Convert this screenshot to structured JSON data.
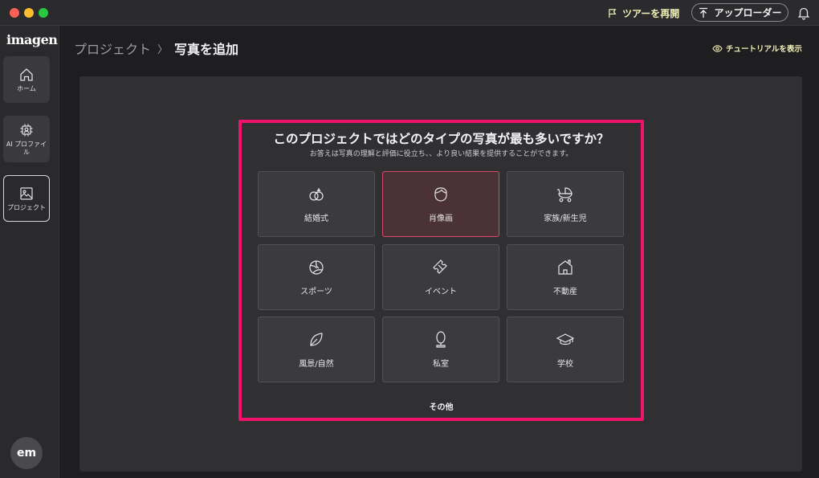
{
  "titlebar": {
    "tour_label": "ツアーを再開",
    "uploader_label": "アップローダー"
  },
  "sidebar": {
    "logo": "imagen",
    "items": [
      {
        "label": "ホーム",
        "icon": "home-icon"
      },
      {
        "label": "AI プロファイル",
        "icon": "ai-chip-icon"
      },
      {
        "label": "プロジェクト",
        "icon": "image-icon"
      }
    ],
    "avatar": "em"
  },
  "header": {
    "crumb_parent": "プロジェクト",
    "crumb_sep": "〉",
    "crumb_current": "写真を追加",
    "tutorial_label": "チュートリアルを表示"
  },
  "main": {
    "question": "このプロジェクトではどのタイプの写真が最も多いですか？",
    "subtitle": "お答えは写真の理解と評価に役立ち、、より良い結果を提供することができます。",
    "categories": [
      {
        "label": "結婚式",
        "icon": "wedding-rings-icon"
      },
      {
        "label": "肖像画",
        "icon": "portrait-icon"
      },
      {
        "label": "家族/新生児",
        "icon": "baby-stroller-icon"
      },
      {
        "label": "スポーツ",
        "icon": "volleyball-icon"
      },
      {
        "label": "イベント",
        "icon": "ticket-icon"
      },
      {
        "label": "不動産",
        "icon": "house-icon"
      },
      {
        "label": "風景/自然",
        "icon": "leaf-icon"
      },
      {
        "label": "私室",
        "icon": "mirror-icon"
      },
      {
        "label": "学校",
        "icon": "graduation-cap-icon"
      }
    ],
    "selected_category": "肖像画",
    "other_label": "その他"
  },
  "colors": {
    "accent_highlight": "#f2126b",
    "selected_border": "#d84a66",
    "tour_text": "#f1f1b8"
  }
}
